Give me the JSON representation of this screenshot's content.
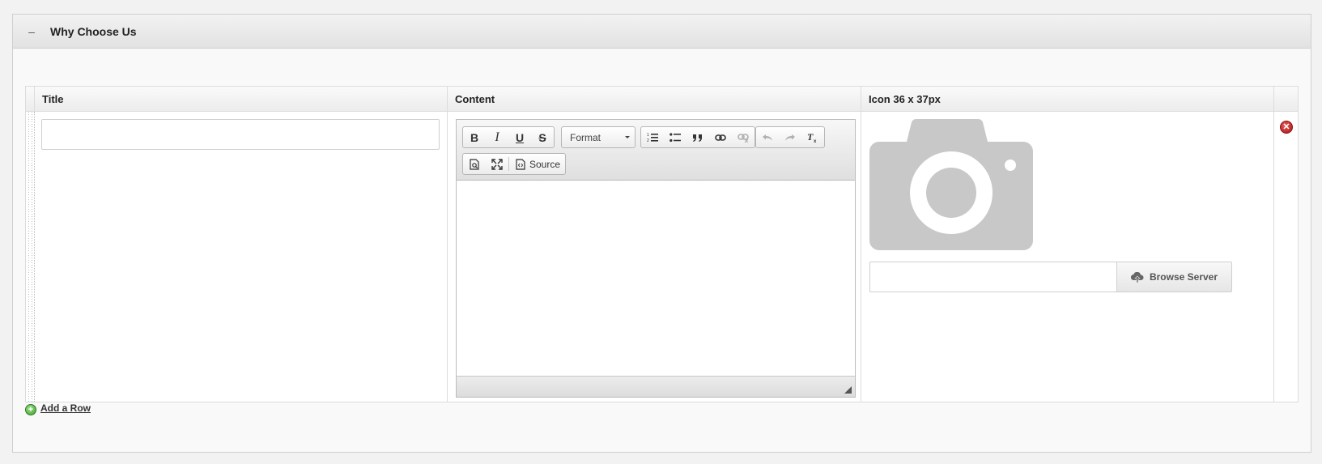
{
  "panel": {
    "toggle_symbol": "–",
    "title": "Why Choose Us"
  },
  "table": {
    "columns": [
      "Title",
      "Content",
      "Icon 36 x 37px"
    ],
    "row": {
      "title_value": "",
      "icon_url_value": ""
    }
  },
  "editor": {
    "toolbar": {
      "bold": "B",
      "italic": "I",
      "underline": "U",
      "strike": "S",
      "format_label": "Format",
      "source_label": "Source"
    }
  },
  "icon_field": {
    "browse_label": "Browse Server",
    "preview_icon": "camera-icon"
  },
  "actions": {
    "remove_symbol": "✕",
    "add_row_symbol": "+",
    "add_row_label": "Add a Row"
  },
  "colors": {
    "remove": "#c0201f",
    "add": "#4aa535",
    "placeholder_gray": "#c8c8c8"
  }
}
